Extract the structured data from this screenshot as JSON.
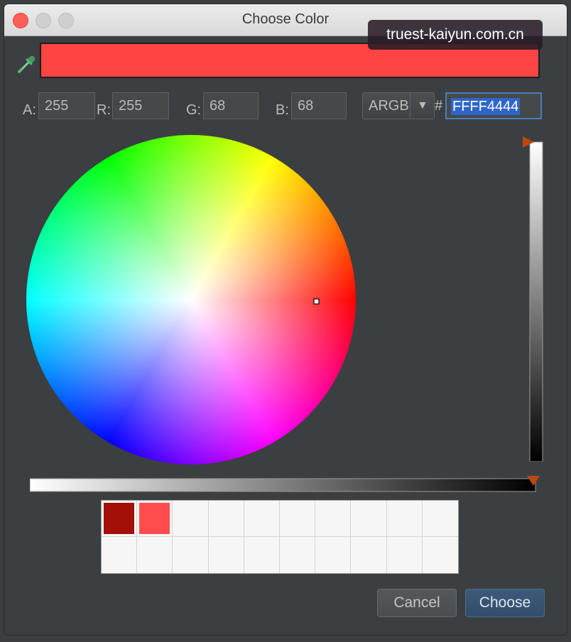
{
  "window": {
    "title": "Choose Color"
  },
  "watermark": "truest-kaiyun.com.cn",
  "preview_color": "#ff4444",
  "fields": {
    "a_label": "A:",
    "a_value": "255",
    "r_label": "R:",
    "r_value": "255",
    "g_label": "G:",
    "g_value": "68",
    "b_label": "B:",
    "b_value": "68"
  },
  "format": {
    "selected": "ARGB",
    "hash_label": "#",
    "hex_value": "FFFF4444"
  },
  "recent_colors": [
    "#a31008",
    "#ff4d4d",
    "",
    "",
    "",
    "",
    "",
    "",
    "",
    "",
    "",
    "",
    "",
    "",
    "",
    "",
    "",
    "",
    "",
    ""
  ],
  "buttons": {
    "cancel": "Cancel",
    "choose": "Choose"
  },
  "colors": {
    "accent": "#2f65ca",
    "slider_handle": "#b84a10",
    "background": "#3c3f41"
  },
  "icons": {
    "eyedropper": "eyedropper-icon",
    "dropdown": "chevron-down-icon"
  }
}
